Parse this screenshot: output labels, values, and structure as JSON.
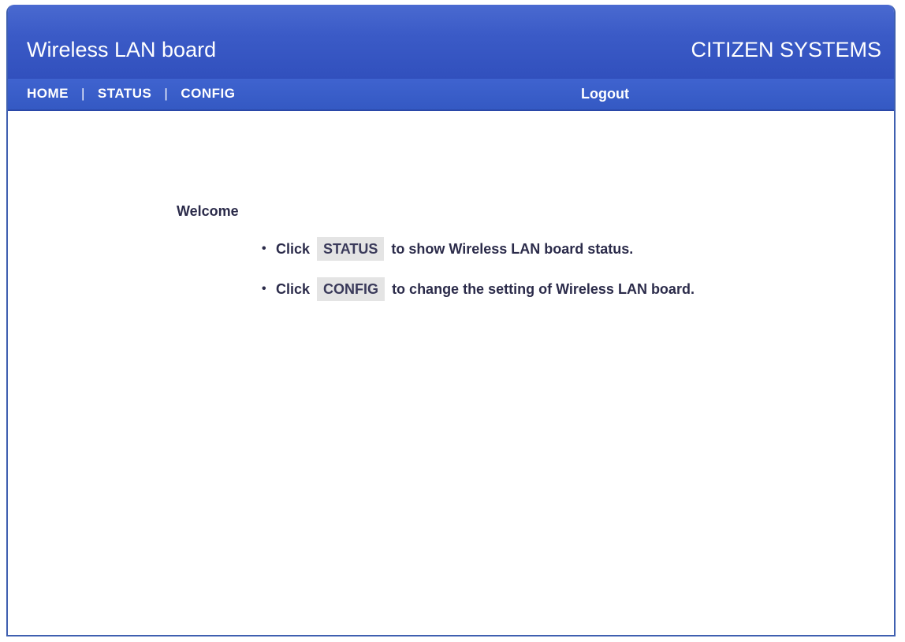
{
  "header": {
    "title": "Wireless LAN board",
    "brand": "CITIZEN SYSTEMS"
  },
  "nav": {
    "home": "HOME",
    "status": "STATUS",
    "config": "CONFIG",
    "separator": "|",
    "logout": "Logout"
  },
  "main": {
    "welcome": "Welcome",
    "items": [
      {
        "bullet": "•",
        "prefix": "Click",
        "button": "STATUS",
        "suffix": "to show Wireless LAN board status."
      },
      {
        "bullet": "•",
        "prefix": "Click",
        "button": "CONFIG",
        "suffix": "to change the setting of Wireless LAN board."
      }
    ]
  },
  "colors": {
    "header_blue": "#3b5bc7",
    "text_dark": "#2b2b4a",
    "button_gray": "#e4e4e4"
  }
}
